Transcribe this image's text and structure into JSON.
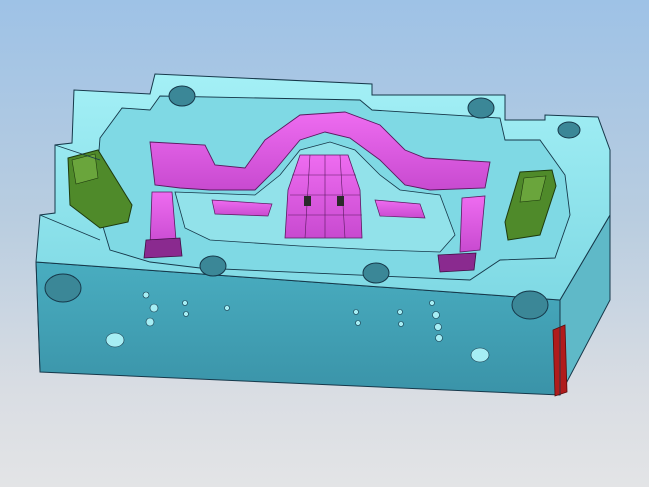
{
  "viewport": {
    "background_top": "#9ec2e6",
    "background_bottom": "#e3e4e6"
  },
  "model": {
    "colors": {
      "plate_top": "#8fe6ee",
      "plate_front": "#3f9fb2",
      "plate_side": "#58b8c8",
      "cavity_surface": "#e25ce6",
      "cavity_dark": "#8a2a8f",
      "slider_green": "#4f8a2a",
      "edge_red": "#b01c1c",
      "edge_lines": "#16384a"
    },
    "components": [
      "mold-plate",
      "cavity",
      "left-slider",
      "right-slider"
    ]
  }
}
